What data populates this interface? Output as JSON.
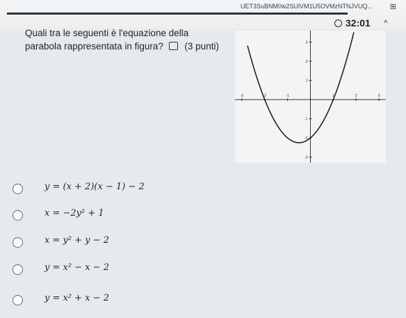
{
  "browser": {
    "url": "UET3SuBNM0w2SUlVM1U5OVMzNTNJVUQ...",
    "timer": "32:01",
    "collapse": "^"
  },
  "question": {
    "text_line1": "Quali tra le seguenti è l'equazione della",
    "text_line2": "parabola rappresentata in figura?",
    "points": "(3 punti)"
  },
  "chart_data": {
    "type": "line",
    "x_ticks": [
      "-3",
      "-2",
      "-1",
      "0",
      "1",
      "2",
      "3"
    ],
    "y_ticks": [
      "3",
      "2",
      "1",
      "-1",
      "-2",
      "-3"
    ],
    "xlim": [
      -3.3,
      3.3
    ],
    "ylim": [
      -3.3,
      3.6
    ],
    "curve": {
      "x": [
        -3,
        -2.5,
        -2,
        -1.5,
        -1,
        -0.5,
        0,
        0.5,
        1,
        1.5,
        2,
        2.5
      ],
      "y": [
        4,
        1.75,
        0,
        -1.25,
        -2,
        -2.25,
        -2,
        -1.25,
        0,
        1.75,
        4,
        6.75
      ]
    },
    "color": "#222222"
  },
  "options": [
    {
      "label": "y = (x + 2)(x − 1) − 2"
    },
    {
      "label": "x = −2y² + 1"
    },
    {
      "label": "x = y² + y − 2"
    },
    {
      "label": "y = x² − x − 2"
    },
    {
      "label": "y = x² + x − 2"
    }
  ]
}
